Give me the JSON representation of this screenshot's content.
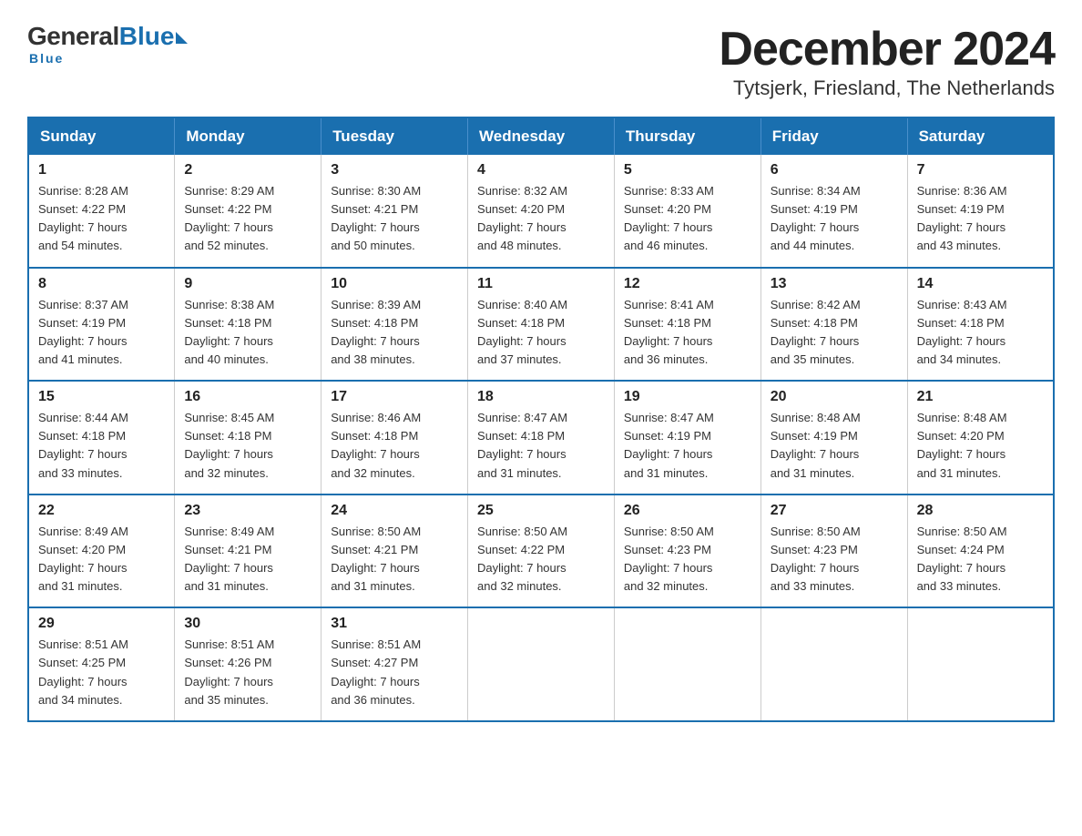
{
  "logo": {
    "general": "General",
    "blue": "Blue",
    "underline": "Blue"
  },
  "title": {
    "month": "December 2024",
    "location": "Tytsjerk, Friesland, The Netherlands"
  },
  "headers": [
    "Sunday",
    "Monday",
    "Tuesday",
    "Wednesday",
    "Thursday",
    "Friday",
    "Saturday"
  ],
  "weeks": [
    [
      {
        "day": "1",
        "info": "Sunrise: 8:28 AM\nSunset: 4:22 PM\nDaylight: 7 hours\nand 54 minutes."
      },
      {
        "day": "2",
        "info": "Sunrise: 8:29 AM\nSunset: 4:22 PM\nDaylight: 7 hours\nand 52 minutes."
      },
      {
        "day": "3",
        "info": "Sunrise: 8:30 AM\nSunset: 4:21 PM\nDaylight: 7 hours\nand 50 minutes."
      },
      {
        "day": "4",
        "info": "Sunrise: 8:32 AM\nSunset: 4:20 PM\nDaylight: 7 hours\nand 48 minutes."
      },
      {
        "day": "5",
        "info": "Sunrise: 8:33 AM\nSunset: 4:20 PM\nDaylight: 7 hours\nand 46 minutes."
      },
      {
        "day": "6",
        "info": "Sunrise: 8:34 AM\nSunset: 4:19 PM\nDaylight: 7 hours\nand 44 minutes."
      },
      {
        "day": "7",
        "info": "Sunrise: 8:36 AM\nSunset: 4:19 PM\nDaylight: 7 hours\nand 43 minutes."
      }
    ],
    [
      {
        "day": "8",
        "info": "Sunrise: 8:37 AM\nSunset: 4:19 PM\nDaylight: 7 hours\nand 41 minutes."
      },
      {
        "day": "9",
        "info": "Sunrise: 8:38 AM\nSunset: 4:18 PM\nDaylight: 7 hours\nand 40 minutes."
      },
      {
        "day": "10",
        "info": "Sunrise: 8:39 AM\nSunset: 4:18 PM\nDaylight: 7 hours\nand 38 minutes."
      },
      {
        "day": "11",
        "info": "Sunrise: 8:40 AM\nSunset: 4:18 PM\nDaylight: 7 hours\nand 37 minutes."
      },
      {
        "day": "12",
        "info": "Sunrise: 8:41 AM\nSunset: 4:18 PM\nDaylight: 7 hours\nand 36 minutes."
      },
      {
        "day": "13",
        "info": "Sunrise: 8:42 AM\nSunset: 4:18 PM\nDaylight: 7 hours\nand 35 minutes."
      },
      {
        "day": "14",
        "info": "Sunrise: 8:43 AM\nSunset: 4:18 PM\nDaylight: 7 hours\nand 34 minutes."
      }
    ],
    [
      {
        "day": "15",
        "info": "Sunrise: 8:44 AM\nSunset: 4:18 PM\nDaylight: 7 hours\nand 33 minutes."
      },
      {
        "day": "16",
        "info": "Sunrise: 8:45 AM\nSunset: 4:18 PM\nDaylight: 7 hours\nand 32 minutes."
      },
      {
        "day": "17",
        "info": "Sunrise: 8:46 AM\nSunset: 4:18 PM\nDaylight: 7 hours\nand 32 minutes."
      },
      {
        "day": "18",
        "info": "Sunrise: 8:47 AM\nSunset: 4:18 PM\nDaylight: 7 hours\nand 31 minutes."
      },
      {
        "day": "19",
        "info": "Sunrise: 8:47 AM\nSunset: 4:19 PM\nDaylight: 7 hours\nand 31 minutes."
      },
      {
        "day": "20",
        "info": "Sunrise: 8:48 AM\nSunset: 4:19 PM\nDaylight: 7 hours\nand 31 minutes."
      },
      {
        "day": "21",
        "info": "Sunrise: 8:48 AM\nSunset: 4:20 PM\nDaylight: 7 hours\nand 31 minutes."
      }
    ],
    [
      {
        "day": "22",
        "info": "Sunrise: 8:49 AM\nSunset: 4:20 PM\nDaylight: 7 hours\nand 31 minutes."
      },
      {
        "day": "23",
        "info": "Sunrise: 8:49 AM\nSunset: 4:21 PM\nDaylight: 7 hours\nand 31 minutes."
      },
      {
        "day": "24",
        "info": "Sunrise: 8:50 AM\nSunset: 4:21 PM\nDaylight: 7 hours\nand 31 minutes."
      },
      {
        "day": "25",
        "info": "Sunrise: 8:50 AM\nSunset: 4:22 PM\nDaylight: 7 hours\nand 32 minutes."
      },
      {
        "day": "26",
        "info": "Sunrise: 8:50 AM\nSunset: 4:23 PM\nDaylight: 7 hours\nand 32 minutes."
      },
      {
        "day": "27",
        "info": "Sunrise: 8:50 AM\nSunset: 4:23 PM\nDaylight: 7 hours\nand 33 minutes."
      },
      {
        "day": "28",
        "info": "Sunrise: 8:50 AM\nSunset: 4:24 PM\nDaylight: 7 hours\nand 33 minutes."
      }
    ],
    [
      {
        "day": "29",
        "info": "Sunrise: 8:51 AM\nSunset: 4:25 PM\nDaylight: 7 hours\nand 34 minutes."
      },
      {
        "day": "30",
        "info": "Sunrise: 8:51 AM\nSunset: 4:26 PM\nDaylight: 7 hours\nand 35 minutes."
      },
      {
        "day": "31",
        "info": "Sunrise: 8:51 AM\nSunset: 4:27 PM\nDaylight: 7 hours\nand 36 minutes."
      },
      null,
      null,
      null,
      null
    ]
  ]
}
